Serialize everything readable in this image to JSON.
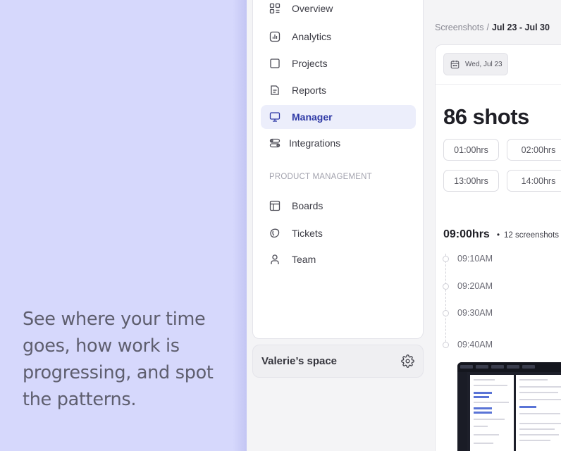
{
  "promo": {
    "text": "See where your time goes, how work is progressing, and spot the patterns."
  },
  "sidebar": {
    "items": [
      {
        "label": "Overview",
        "icon": "grid-icon"
      },
      {
        "label": "Analytics",
        "icon": "chart-icon"
      },
      {
        "label": "Projects",
        "icon": "folder-icon"
      },
      {
        "label": "Reports",
        "icon": "document-icon"
      },
      {
        "label": "Manager",
        "icon": "monitor-icon",
        "active": true
      },
      {
        "label": "Integrations",
        "icon": "toggles-icon"
      }
    ],
    "section_label": "PRODUCT MANAGEMENT",
    "section_items": [
      {
        "label": "Boards",
        "icon": "board-icon"
      },
      {
        "label": "Tickets",
        "icon": "ticket-icon"
      },
      {
        "label": "Team",
        "icon": "user-icon"
      }
    ]
  },
  "space": {
    "name": "Valerie’s space",
    "icon": "gear-icon"
  },
  "breadcrumb": {
    "parent": "Screenshots",
    "separator": "/",
    "current": "Jul 23 - Jul 30"
  },
  "main": {
    "date_chip": "Wed, Jul 23",
    "shots_count": "86 shots",
    "hour_pills": [
      "01:00hrs",
      "02:00hrs",
      "13:00hrs",
      "14:00hrs"
    ],
    "group": {
      "hour": "09:00hrs",
      "bullet": "•",
      "count": "12 screenshots"
    },
    "timeline": [
      "09:10AM",
      "09:20AM",
      "09:30AM",
      "09:40AM"
    ]
  },
  "colors": {
    "promo_bg": "#d6d8fc",
    "active_bg": "#eceefb",
    "active_text": "#2f3aa6"
  }
}
